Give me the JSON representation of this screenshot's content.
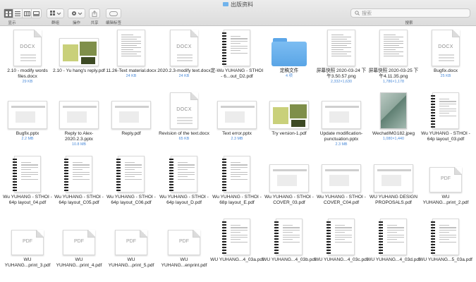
{
  "window": {
    "title": "出版资料"
  },
  "toolbar": {
    "view_label": "显示",
    "group_label": "群组",
    "action_label": "操作",
    "share_label": "共享",
    "tags_label": "编辑标签",
    "search_placeholder": "搜索",
    "search_label": "搜索"
  },
  "files": [
    {
      "name": "2.10 - modify words files.docx",
      "size": "29 KB",
      "kind": "docx"
    },
    {
      "name": "2.10 - Yu hang's reply.pdf",
      "size": "",
      "kind": "photo"
    },
    {
      "name": "11.26-Text material.docx",
      "size": "24 KB",
      "kind": "text"
    },
    {
      "name": "2020.2.3-modify text.docx",
      "size": "24 KB",
      "kind": "docx"
    },
    {
      "name": "定-Wu YUHANG - STHOI - 6...out_D2.pdf",
      "size": "",
      "kind": "spiral"
    },
    {
      "name": "定稿文件",
      "size": "4 项",
      "kind": "folder"
    },
    {
      "name": "屏幕快照 2020-03-24 下午3.50.57.png",
      "size": "2,332×1,630",
      "kind": "text"
    },
    {
      "name": "屏幕快照 2020-03-25 下午4.11.35.png",
      "size": "1,786×1,178",
      "kind": "text"
    },
    {
      "name": "Bugfix.docx",
      "size": "25 KB",
      "kind": "docx"
    },
    {
      "name": "Bugfix.pptx",
      "size": "2.2 MB",
      "kind": "land"
    },
    {
      "name": "Reply to Alex-2020.2.3.pptx",
      "size": "10.8 MB",
      "kind": "land"
    },
    {
      "name": "Reply.pdf",
      "size": "",
      "kind": "land"
    },
    {
      "name": "Revision of the text.docx",
      "size": "65 KB",
      "kind": "docx"
    },
    {
      "name": "Text error.pptx",
      "size": "2.3 MB",
      "kind": "land"
    },
    {
      "name": "Try version-1.pdf",
      "size": "",
      "kind": "photo"
    },
    {
      "name": "Update modification-punctuation.pptx",
      "size": "2.3 MB",
      "kind": "land"
    },
    {
      "name": "WechatIMG182.jpeg",
      "size": "1,080×1,440",
      "kind": "jpeg"
    },
    {
      "name": "Wu YUHANG - STHOI - 64p layout_03.pdf",
      "size": "",
      "kind": "spiral"
    },
    {
      "name": "Wu YUHANG - STHOI - 64p layout_04.pdf",
      "size": "",
      "kind": "spiral"
    },
    {
      "name": "Wu YUHANG - STHOI - 64p layout_C05.pdf",
      "size": "",
      "kind": "spiral"
    },
    {
      "name": "Wu YUHANG - STHOI - 64p layout_C06.pdf",
      "size": "",
      "kind": "spiral"
    },
    {
      "name": "Wu YUHANG - STHOI - 64p layout_D.pdf",
      "size": "",
      "kind": "spiral"
    },
    {
      "name": "Wu YUHANG - STHOI - 68p layout_E.pdf",
      "size": "",
      "kind": "spiral"
    },
    {
      "name": "Wu YUHANG - STHOI - COVER_03.pdf",
      "size": "",
      "kind": "land"
    },
    {
      "name": "Wu YUHANG - STHOI - COVER_C04.pdf",
      "size": "",
      "kind": "land"
    },
    {
      "name": "WU YUHANG DESIGN PROPOSALS.pdf",
      "size": "",
      "kind": "land"
    },
    {
      "name": "WU YUHANG...print_2.pdf",
      "size": "",
      "kind": "pdf"
    },
    {
      "name": "WU YUHANG...print_3.pdf",
      "size": "",
      "kind": "pdf"
    },
    {
      "name": "WU YUHANG...print_4.pdf",
      "size": "",
      "kind": "pdf"
    },
    {
      "name": "WU YUHANG...print_5.pdf",
      "size": "",
      "kind": "pdf"
    },
    {
      "name": "WU YUHANG...enprint.pdf",
      "size": "",
      "kind": "pdf"
    },
    {
      "name": "WU YUHANG...4_03a.pdf",
      "size": "",
      "kind": "spiral"
    },
    {
      "name": "WU YUHANG...4_03b.pdf",
      "size": "",
      "kind": "spiral"
    },
    {
      "name": "WU YUHANG...4_03c.pdf",
      "size": "",
      "kind": "spiral"
    },
    {
      "name": "WU YUHANG...4_03d.pdf",
      "size": "",
      "kind": "spiral"
    },
    {
      "name": "WU YUHANG...5_03a.pdf",
      "size": "",
      "kind": "spiral"
    }
  ],
  "icon_labels": {
    "docx": "DOCX",
    "pdf": "PDF"
  },
  "colors": {
    "accent": "#4a8ad8",
    "folder": "#6fb3ee"
  }
}
